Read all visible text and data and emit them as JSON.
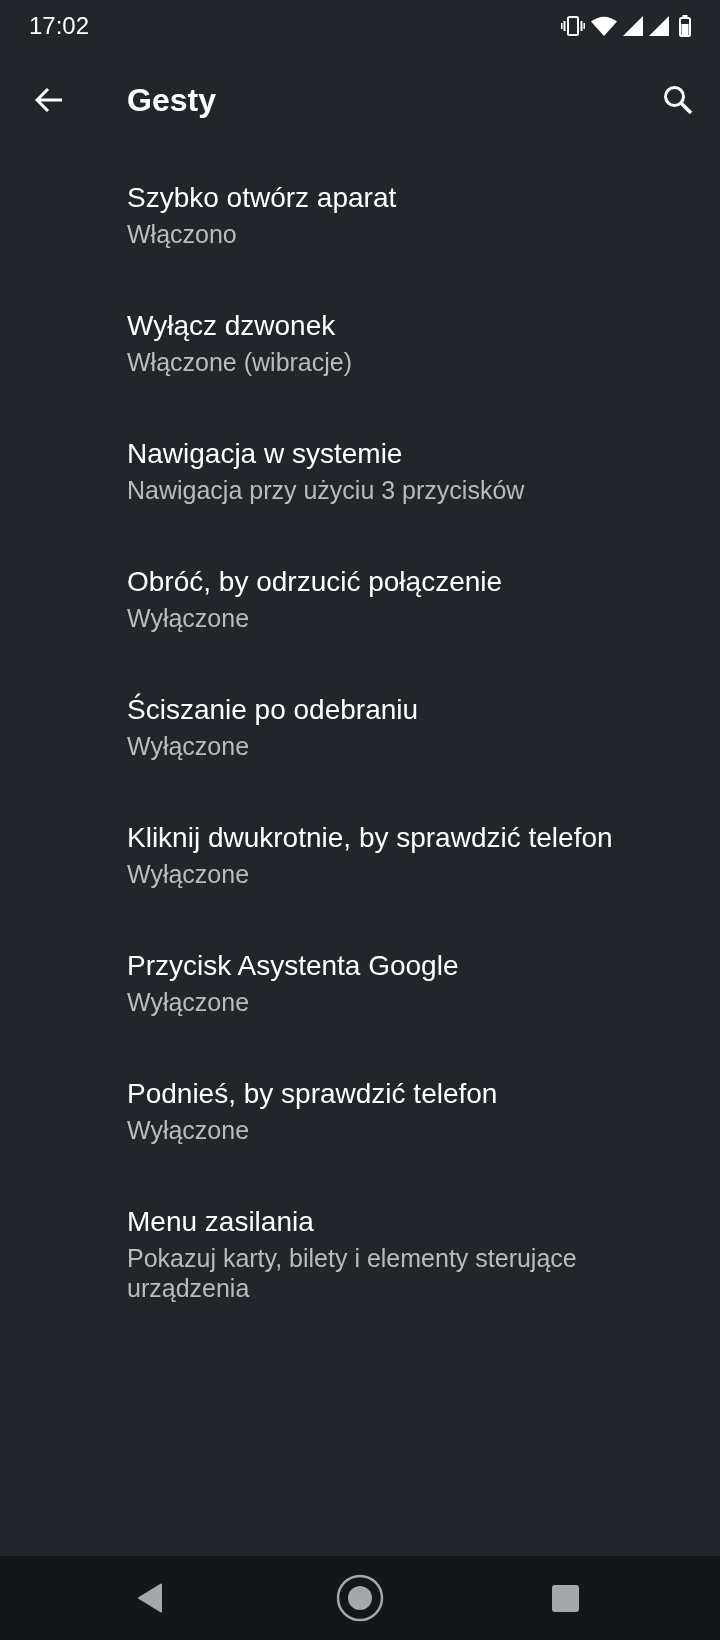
{
  "status_bar": {
    "time": "17:02"
  },
  "toolbar": {
    "title": "Gesty"
  },
  "settings": [
    {
      "title": "Szybko otwórz aparat",
      "summary": "Włączono"
    },
    {
      "title": "Wyłącz dzwonek",
      "summary": "Włączone (wibracje)"
    },
    {
      "title": "Nawigacja w systemie",
      "summary": "Nawigacja przy użyciu 3 przycisków"
    },
    {
      "title": "Obróć, by odrzucić połączenie",
      "summary": "Wyłączone"
    },
    {
      "title": "Ściszanie po odebraniu",
      "summary": "Wyłączone"
    },
    {
      "title": "Kliknij dwukrotnie, by sprawdzić telefon",
      "summary": "Wyłączone"
    },
    {
      "title": "Przycisk Asystenta Google",
      "summary": "Wyłączone"
    },
    {
      "title": "Podnieś, by sprawdzić telefon",
      "summary": "Wyłączone"
    },
    {
      "title": "Menu zasilania",
      "summary": "Pokazuj karty, bilety i elementy sterujące urządzenia"
    }
  ]
}
